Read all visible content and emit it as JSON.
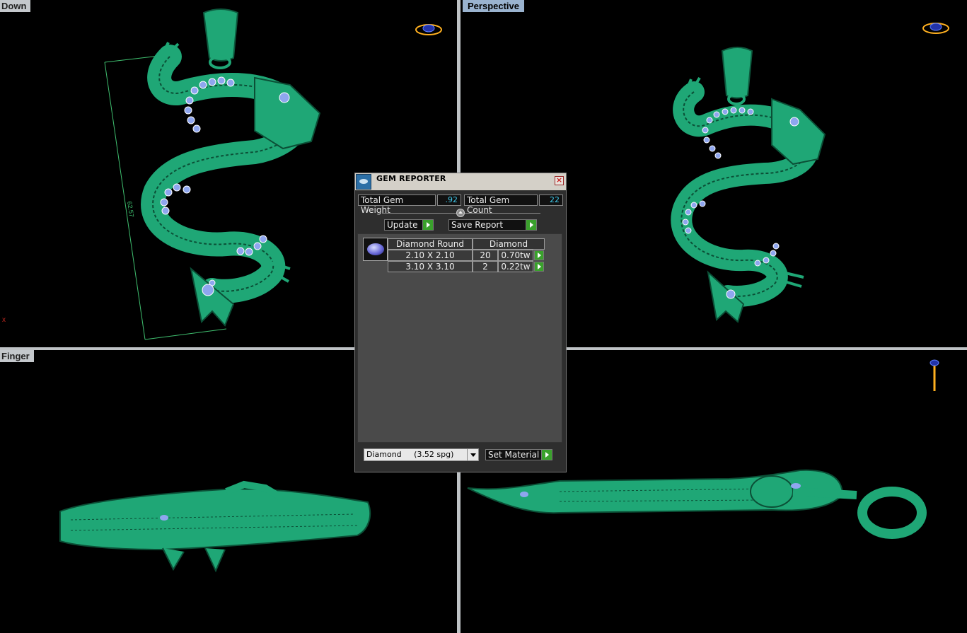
{
  "viewports": {
    "top_left": {
      "label": "Down",
      "dimension_text": "62.57",
      "axis_marker": "x"
    },
    "top_right": {
      "label": "Perspective"
    },
    "bottom_left": {
      "label": "Finger"
    },
    "bottom_right": {
      "label": ""
    }
  },
  "colors": {
    "model_green": "#1faa78",
    "gem_blue": "#8fa6ef",
    "dimension_line": "#3fbf6f",
    "viewport_bg": "#000000",
    "divider": "#bfc3c6",
    "nav_orange": "#ffb020"
  },
  "gem_reporter": {
    "title": "GEM REPORTER",
    "total_gem_weight_label": "Total Gem Weight",
    "total_gem_weight_value": ".92",
    "total_gem_count_label": "Total Gem Count",
    "total_gem_count_value": "22",
    "update_label": "Update",
    "save_report_label": "Save Report",
    "table": {
      "shape_header": "Diamond Round",
      "material_header": "Diamond",
      "rows": [
        {
          "size": "2.10 X 2.10",
          "count": "20",
          "weight": "0.70tw"
        },
        {
          "size": "3.10 X 3.10",
          "count": "2",
          "weight": "0.22tw"
        }
      ]
    },
    "material_select_value": "Diamond     (3.52 spg)",
    "set_material_label": "Set Material"
  }
}
